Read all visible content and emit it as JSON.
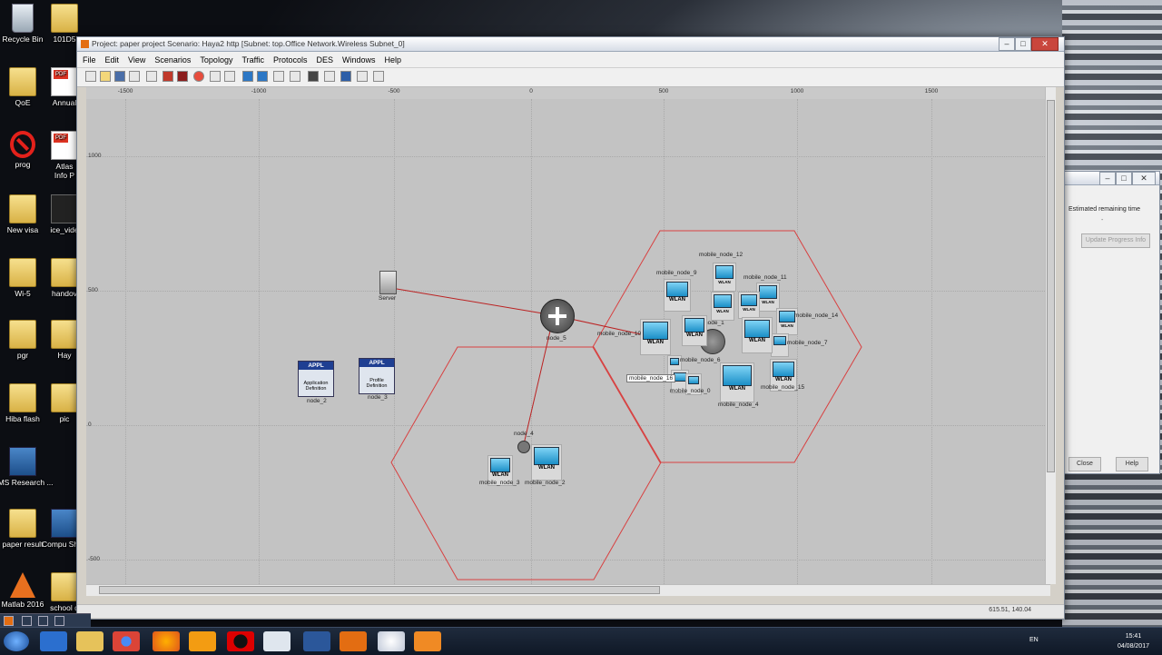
{
  "desktop": {
    "icons": [
      {
        "label": "Recycle Bin",
        "icon": "recycle-bin-icon"
      },
      {
        "label": "101D5",
        "icon": "folder-icon"
      },
      {
        "label": "QoE",
        "icon": "folder-icon"
      },
      {
        "label": "Annual",
        "icon": "pdf-icon"
      },
      {
        "label": "prog",
        "icon": "no-entry-icon"
      },
      {
        "label": "Atlas",
        "icon": "pdf-icon"
      },
      {
        "label": "Info P",
        "icon": ""
      },
      {
        "label": "New visa",
        "icon": "folder-icon"
      },
      {
        "label": "ice_vide",
        "icon": "video-icon"
      },
      {
        "label": "Wi-5",
        "icon": "folder-icon"
      },
      {
        "label": "handov",
        "icon": "folder-icon"
      },
      {
        "label": "pgr",
        "icon": "folder-icon"
      },
      {
        "label": "Hay",
        "icon": "folder-icon"
      },
      {
        "label": "Hiba flash",
        "icon": "folder-icon"
      },
      {
        "label": "pic",
        "icon": "folder-icon"
      },
      {
        "label": "CMS Research ...",
        "icon": "computer-icon"
      },
      {
        "label": "paper result",
        "icon": "folder-icon"
      },
      {
        "label": "Compu Short",
        "icon": "computer-icon"
      },
      {
        "label": "Matlab 2016",
        "icon": "matlab-icon"
      },
      {
        "label": "school d",
        "icon": "folder-icon"
      }
    ]
  },
  "window": {
    "title": "Project: paper project Scenario: Haya2 http  [Subnet: top.Office Network.Wireless Subnet_0]",
    "menu": [
      "File",
      "Edit",
      "View",
      "Scenarios",
      "Topology",
      "Traffic",
      "Protocols",
      "DES",
      "Windows",
      "Help"
    ],
    "controls": {
      "minimize": "–",
      "maximize": "□",
      "close": "✕"
    }
  },
  "ruler": {
    "x_ticks": [
      "-1500",
      "-1000",
      "-500",
      "0",
      "500",
      "1000",
      "1500"
    ],
    "y_ticks": [
      "1000",
      "500",
      "0",
      "-500"
    ]
  },
  "network": {
    "server": {
      "label": "Server"
    },
    "router": {
      "label": "node_5"
    },
    "app_def": {
      "badge": "APPL",
      "line1": "Application",
      "line2": "Definition",
      "label": "node_2"
    },
    "profile_def": {
      "badge": "APPL",
      "line1": "Profile",
      "line2": "Definition",
      "label": "node_3"
    },
    "access_points": [
      {
        "label": "node_4"
      },
      {
        "label": "node_1"
      }
    ],
    "wlan_text": "WLAN",
    "mobile_nodes": [
      {
        "label": "mobile_node_12"
      },
      {
        "label": "mobile_node_9"
      },
      {
        "label": "mobile_node_11"
      },
      {
        "label": "mobile_node_14"
      },
      {
        "label": "mobile_node_10"
      },
      {
        "label": "mobile_node_7"
      },
      {
        "label": "mobile_node_6"
      },
      {
        "label": "mobile_node_16"
      },
      {
        "label": "mobile_node_0"
      },
      {
        "label": "mobile_node_15"
      },
      {
        "label": "mobile_node_4"
      },
      {
        "label": "mobile_node_3"
      },
      {
        "label": "mobile_node_2"
      }
    ]
  },
  "status": {
    "coords": "615.51, 140.04"
  },
  "progress_dialog": {
    "label": "Estimated remaining time",
    "value": "-",
    "update_button": "Update Progress Info",
    "close_button": "Close",
    "help_button": "Help"
  },
  "taskbar": {
    "apps": [
      "start",
      "ie",
      "explorer",
      "chrome",
      "firefox",
      "media-player",
      "opera",
      "teamviewer",
      "word",
      "opnet",
      "itunes",
      "opnet-alt"
    ],
    "lang": "EN",
    "time": "15:41",
    "date": "04/08/2017"
  }
}
